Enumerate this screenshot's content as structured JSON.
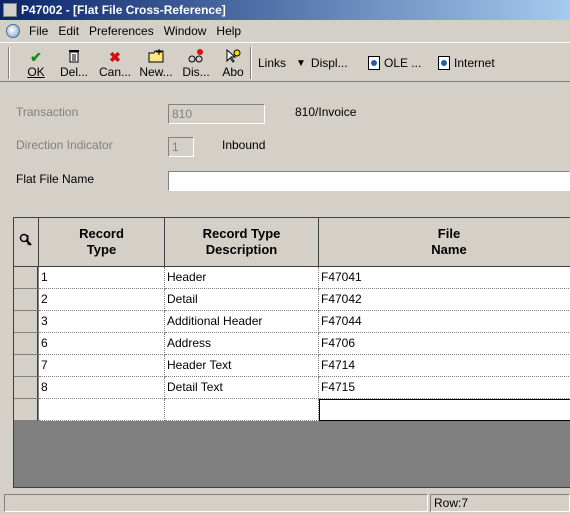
{
  "window": {
    "title": "P47002 - [Flat File Cross-Reference]"
  },
  "menu": {
    "items": [
      "File",
      "Edit",
      "Preferences",
      "Window",
      "Help"
    ]
  },
  "toolbar": {
    "buttons": [
      {
        "label": "OK",
        "icon": "check-icon"
      },
      {
        "label": "Del...",
        "icon": "trash-icon"
      },
      {
        "label": "Can...",
        "icon": "cancel-x-icon"
      },
      {
        "label": "New...",
        "icon": "new-folder-icon"
      },
      {
        "label": "Dis...",
        "icon": "display-icon"
      },
      {
        "label": "Abo",
        "icon": "about-icon"
      }
    ],
    "links_label": "Links",
    "display_label": "Displ...",
    "ole_label": "OLE ...",
    "internet_label": "Internet"
  },
  "form": {
    "transaction_label": "Transaction",
    "transaction_value": "810",
    "transaction_desc": "810/Invoice",
    "direction_label": "Direction Indicator",
    "direction_value": "1",
    "direction_desc": "Inbound",
    "flatfile_label": "Flat File Name",
    "flatfile_value": ""
  },
  "grid": {
    "headers": [
      "Record Type",
      "Record Type Description",
      "File Name"
    ],
    "rows": [
      {
        "record_type": "1",
        "description": "Header",
        "file_name": "F47041"
      },
      {
        "record_type": "2",
        "description": "Detail",
        "file_name": "F47042"
      },
      {
        "record_type": "3",
        "description": "Additional Header",
        "file_name": "F47044"
      },
      {
        "record_type": "6",
        "description": "Address",
        "file_name": "F4706"
      },
      {
        "record_type": "7",
        "description": "Header Text",
        "file_name": "F4714"
      },
      {
        "record_type": "8",
        "description": "Detail Text",
        "file_name": "F4715"
      }
    ]
  },
  "status": {
    "row_text": "Row:7"
  }
}
